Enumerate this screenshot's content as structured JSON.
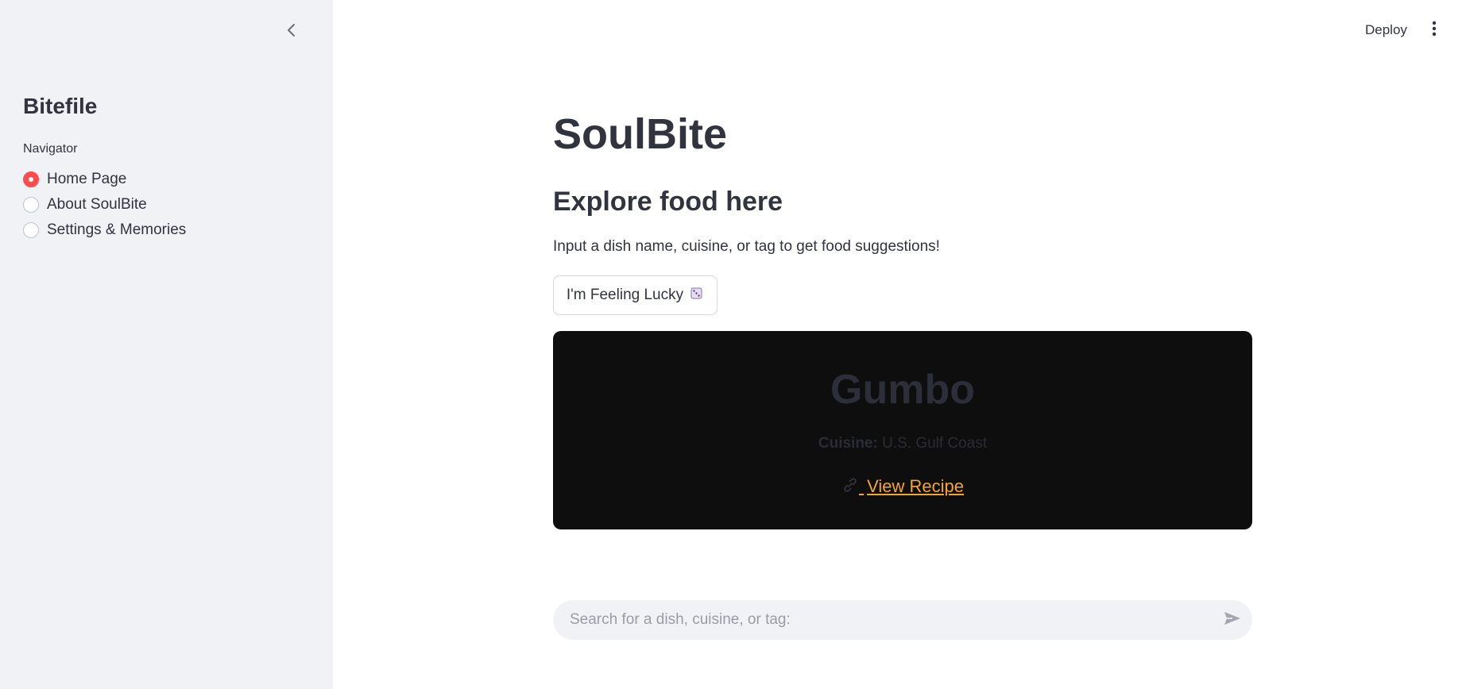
{
  "sidebar": {
    "title": "Bitefile",
    "navigator_label": "Navigator",
    "items": [
      {
        "label": "Home Page",
        "selected": true
      },
      {
        "label": "About SoulBite",
        "selected": false
      },
      {
        "label": "Settings & Memories",
        "selected": false
      }
    ],
    "collapse_icon": "chevron-left-icon"
  },
  "header": {
    "deploy_label": "Deploy",
    "menu_icon": "more-vertical-icon"
  },
  "main": {
    "title": "SoulBite",
    "subtitle": "Explore food here",
    "description": "Input a dish name, cuisine, or tag to get food suggestions!",
    "lucky_button_label": "I'm Feeling Lucky",
    "lucky_button_icon": "dice-icon",
    "card": {
      "dish_name": "Gumbo",
      "cuisine_label": "Cuisine:",
      "cuisine_value": "U.S. Gulf Coast",
      "link_label": "View Recipe",
      "link_icon": "link-icon"
    },
    "search": {
      "placeholder": "Search for a dish, cuisine, or tag:",
      "value": "",
      "send_icon": "send-icon"
    }
  },
  "colors": {
    "accent": "#ff4b4b",
    "link": "#f5a623",
    "card_bg": "#0e0e0e",
    "sidebar_bg": "#f0f2f6"
  }
}
